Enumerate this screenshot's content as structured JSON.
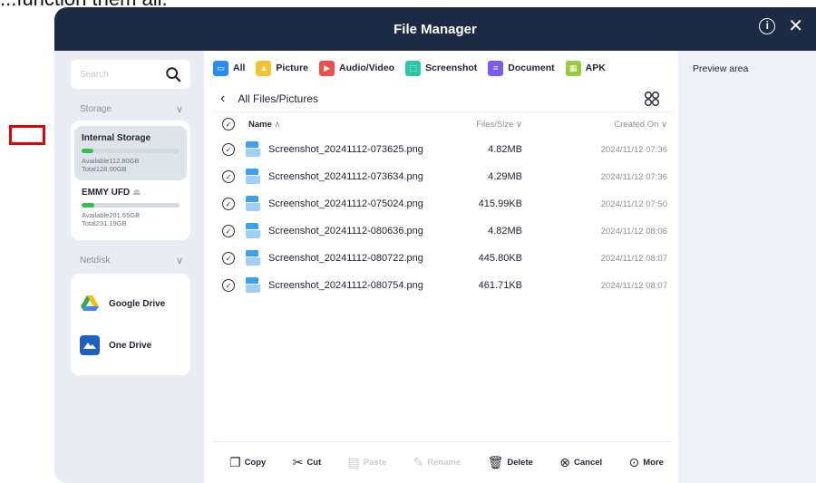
{
  "top_snippet": "...function them all.",
  "window": {
    "title": "File Manager"
  },
  "sidebar": {
    "search_placeholder": "Search",
    "storage_header": "Storage",
    "storage": [
      {
        "name": "Internal Storage",
        "used_fraction": 0.12,
        "available": "Available112.80GB",
        "total": "Total128.00GB"
      },
      {
        "name": "EMMY UFD",
        "used_fraction": 0.13,
        "available": "Available201.65GB",
        "total": "Total231.19GB"
      }
    ],
    "netdisk_header": "Netdisk",
    "drives": [
      {
        "label": "Google Drive"
      },
      {
        "label": "One Drive"
      }
    ]
  },
  "tabs": [
    {
      "label": "All",
      "color": "#2a8cf0"
    },
    {
      "label": "Picture",
      "color": "#f2c233"
    },
    {
      "label": "Audio/Video",
      "color": "#ee4d4d"
    },
    {
      "label": "Screenshot",
      "color": "#2cc6a3"
    },
    {
      "label": "Document",
      "color": "#7a5cf0"
    },
    {
      "label": "APK",
      "color": "#9acb3b"
    }
  ],
  "path": "All Files/Pictures",
  "columns": {
    "name": "Name",
    "size": "Files/Size",
    "created": "Created On"
  },
  "files": [
    {
      "name": "Screenshot_20241112-073625.png",
      "size": "4.82MB",
      "created": "2024/11/12 07:36"
    },
    {
      "name": "Screenshot_20241112-073634.png",
      "size": "4.29MB",
      "created": "2024/11/12 07:36"
    },
    {
      "name": "Screenshot_20241112-075024.png",
      "size": "415.99KB",
      "created": "2024/11/12 07:50"
    },
    {
      "name": "Screenshot_20241112-080636.png",
      "size": "4.82MB",
      "created": "2024/11/12 08:06"
    },
    {
      "name": "Screenshot_20241112-080722.png",
      "size": "445.80KB",
      "created": "2024/11/12 08:07"
    },
    {
      "name": "Screenshot_20241112-080754.png",
      "size": "461.71KB",
      "created": "2024/11/12 08:07"
    }
  ],
  "actions": {
    "copy": "Copy",
    "cut": "Cut",
    "paste": "Paste",
    "rename": "Rename",
    "delete": "Delete",
    "cancel": "Cancel",
    "more": "More"
  },
  "preview_label": "Preview area"
}
